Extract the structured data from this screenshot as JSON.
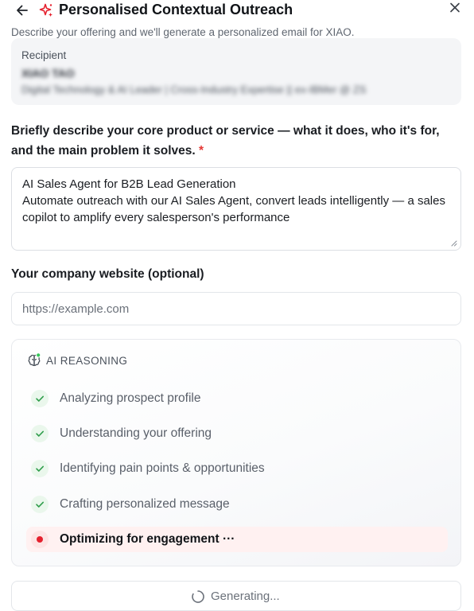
{
  "header": {
    "title": "Personalised Contextual Outreach",
    "subtitle": "Describe your offering and we'll generate a personalized email for XIAO."
  },
  "recipient": {
    "label": "Recipient",
    "name": "XIAO TAO",
    "headline": "Digital Technology & AI Leader | Cross-Industry Expertise || ex-IBMer @ ZS"
  },
  "form": {
    "offering_question": "Briefly describe your core product or service — what it does, who it's for, and the main problem it solves.",
    "required_marker": "*",
    "offering_value": "AI Sales Agent for B2B Lead Generation\nAutomate outreach with our AI Sales Agent, convert leads intelligently — a sales copilot to amplify every salesperson's performance",
    "website_label": "Your company website (optional)",
    "website_placeholder": "https://example.com",
    "website_value": ""
  },
  "reasoning": {
    "title": "AI REASONING",
    "steps": [
      {
        "label": "Analyzing prospect profile",
        "status": "done"
      },
      {
        "label": "Understanding your offering",
        "status": "done"
      },
      {
        "label": "Identifying pain points & opportunities",
        "status": "done"
      },
      {
        "label": "Crafting personalized message",
        "status": "done"
      },
      {
        "label": "Optimizing for engagement ···",
        "status": "active"
      }
    ]
  },
  "generate_button": {
    "label": "Generating..."
  },
  "colors": {
    "accent": "#e5212e",
    "check": "#2e9d4a",
    "status_dot": "#34c759"
  },
  "icons": {
    "back": "arrow-left-icon",
    "title": "sparkles-icon",
    "close": "close-icon",
    "reasoning": "brain-icon",
    "step_done": "check-icon",
    "loading": "spinner-icon"
  }
}
